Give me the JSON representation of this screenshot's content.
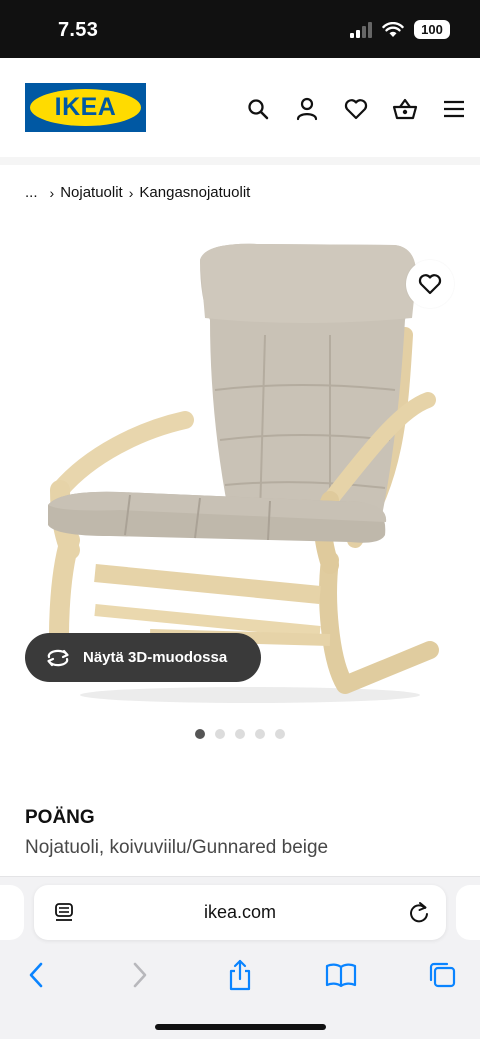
{
  "status_bar": {
    "time": "7.53",
    "battery": "100",
    "icons": [
      "signal-icon",
      "wifi-icon",
      "battery-icon"
    ]
  },
  "header": {
    "logo_text": "IKEA",
    "icons": [
      "search-icon",
      "account-icon",
      "favourites-icon",
      "basket-icon",
      "menu-icon"
    ]
  },
  "breadcrumb": {
    "ellipsis": "...",
    "items": [
      "Nojatuolit",
      "Kangasnojatuolit"
    ]
  },
  "gallery": {
    "view_3d_label": "Näytä 3D-muodossa",
    "dots_count": 5,
    "active_index": 0
  },
  "product": {
    "name": "POÄNG",
    "description": "Nojatuoli, koivuviilu/Gunnared beige"
  },
  "browser": {
    "url": "ikea.com",
    "icons": [
      "reader-icon",
      "reload-icon",
      "back-icon",
      "forward-icon",
      "share-icon",
      "bookmarks-icon",
      "tabs-icon"
    ]
  },
  "colors": {
    "ikea_blue": "#0058a3",
    "ikea_yellow": "#ffdb00",
    "button_dark": "#3a3a3a",
    "ios_blue": "#0a84ff"
  }
}
